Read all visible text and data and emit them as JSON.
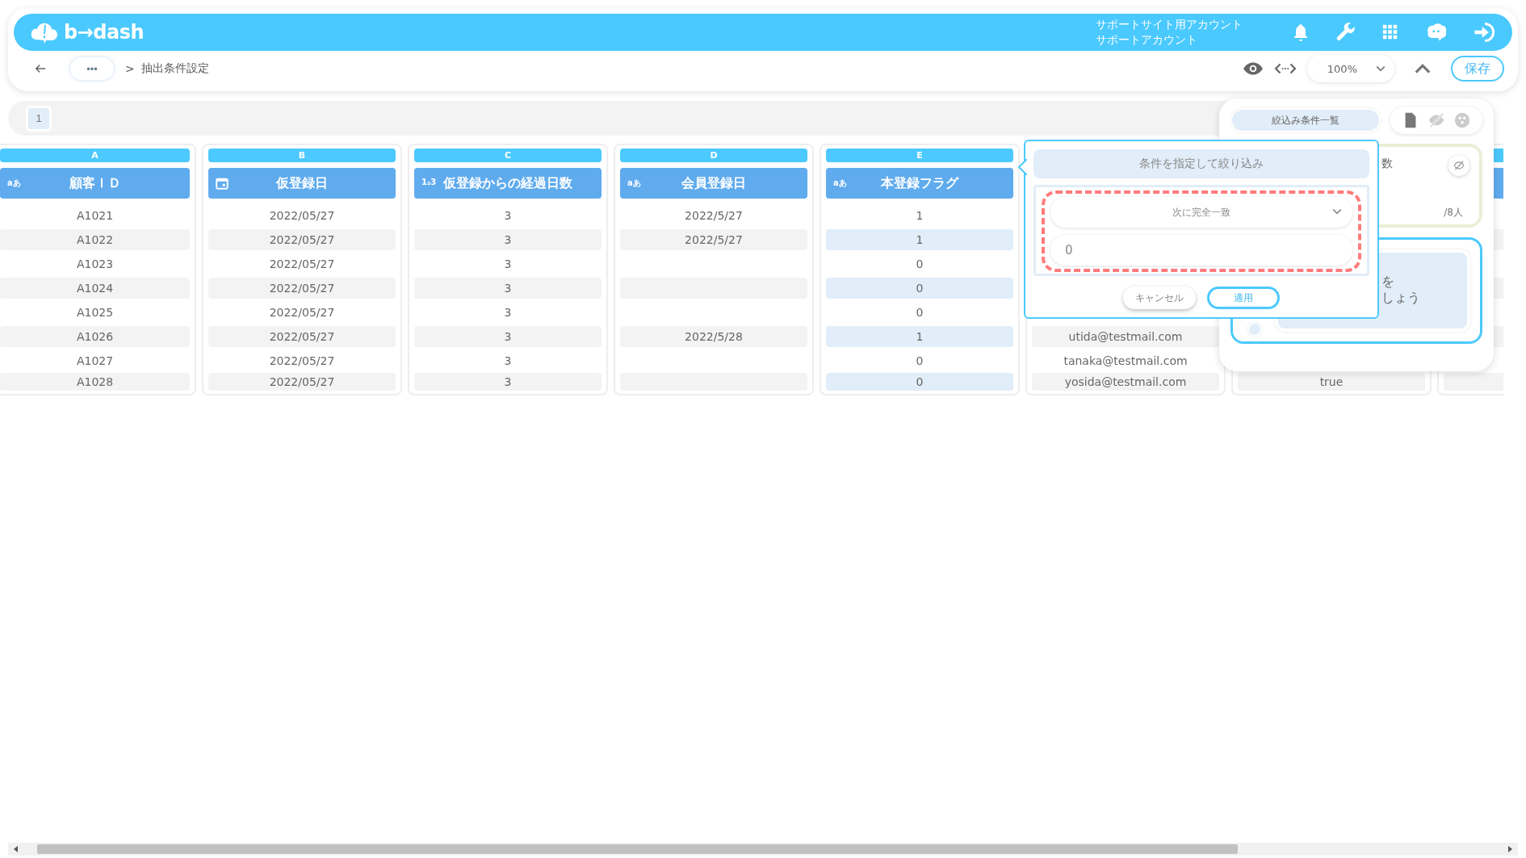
{
  "header": {
    "logo": "b→dash",
    "account_lines": [
      "サポートサイト用アカウント",
      "サポートアカウント"
    ]
  },
  "breadcrumb": {
    "more": "•••",
    "separator": ">",
    "current": "抽出条件設定"
  },
  "toolbar": {
    "zoom": "100%",
    "save": "保存"
  },
  "sheet_tabs": [
    {
      "label": "1",
      "selected": true
    }
  ],
  "columns": [
    {
      "letter": "A",
      "title": "顧客ＩＤ",
      "kind": "text",
      "kind_label": "aあ",
      "selected": false,
      "cells": [
        "A1021",
        "A1022",
        "A1023",
        "A1024",
        "A1025",
        "A1026",
        "A1027",
        "A1028"
      ]
    },
    {
      "letter": "B",
      "title": "仮登録日",
      "kind": "date",
      "selected": false,
      "cells": [
        "2022/05/27",
        "2022/05/27",
        "2022/05/27",
        "2022/05/27",
        "2022/05/27",
        "2022/05/27",
        "2022/05/27",
        "2022/05/27"
      ]
    },
    {
      "letter": "C",
      "title": "仮登録からの経過日数",
      "kind": "number",
      "kind_label": "1₂3",
      "selected": false,
      "cells": [
        "3",
        "3",
        "3",
        "3",
        "3",
        "3",
        "3",
        "3"
      ]
    },
    {
      "letter": "D",
      "title": "会員登録日",
      "kind": "text",
      "kind_label": "aあ",
      "selected": false,
      "cells": [
        "2022/5/27",
        "2022/5/27",
        null,
        null,
        null,
        "2022/5/28",
        null,
        null
      ]
    },
    {
      "letter": "E",
      "title": "本登録フラグ",
      "kind": "text",
      "kind_label": "aあ",
      "selected": true,
      "cells": [
        "1",
        "1",
        "0",
        "0",
        "0",
        "1",
        "0",
        "0"
      ]
    },
    {
      "selected": false,
      "cells": [
        null,
        null,
        null,
        null,
        null,
        "utida@testmail.com",
        "tanaka@testmail.com",
        "yosida@testmail.com"
      ]
    },
    {
      "selected": false,
      "cells": [
        null,
        null,
        null,
        null,
        null,
        null,
        null,
        "true"
      ]
    },
    {
      "selected": false,
      "cells": [
        null,
        null,
        null,
        null,
        null,
        null,
        null,
        null
      ]
    }
  ],
  "filter_popup": {
    "title": "条件を指定して絞り込み",
    "operator": "次に完全一致",
    "value": "0",
    "cancel": "キャンセル",
    "apply": "適用"
  },
  "side_panel": {
    "tab": "絞込み条件一覧",
    "cards": [
      {
        "kind": "condition",
        "texts": [
          "数"
        ],
        "count": "/8人"
      },
      {
        "kind": "hint",
        "texts": [
          "を",
          "しょう"
        ],
        "selected": false
      }
    ]
  }
}
